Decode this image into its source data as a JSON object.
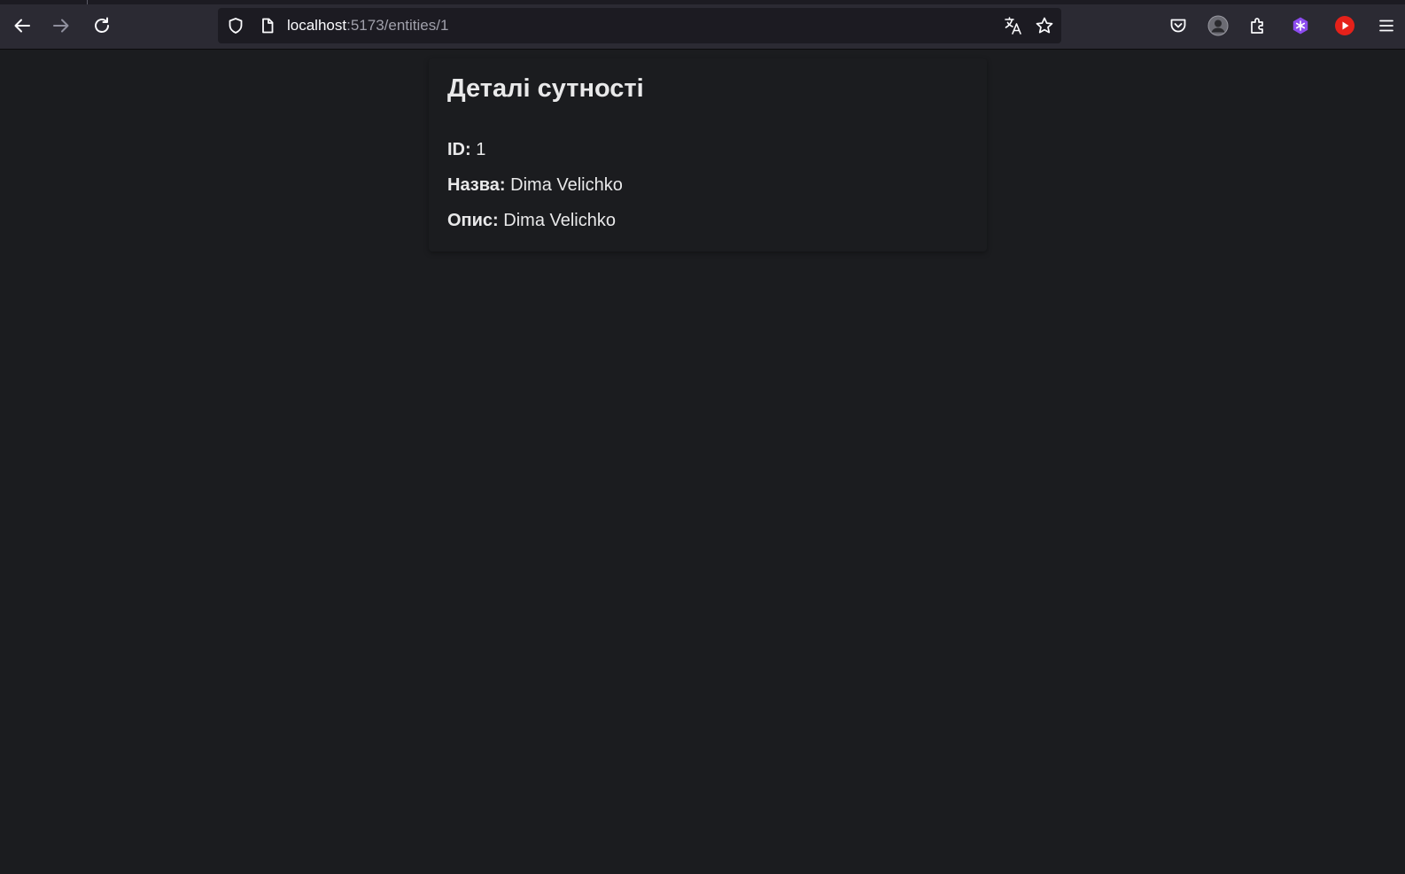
{
  "browser": {
    "url_host": "localhost",
    "url_path": ":5173/entities/1",
    "icons": {
      "back": "arrow-left-icon",
      "forward": "arrow-right-icon",
      "reload": "reload-icon",
      "tracking_protection": "shield-icon",
      "page_info": "page-icon",
      "translate": "translate-icon",
      "bookmark": "star-icon",
      "pocket": "pocket-icon",
      "account": "avatar-icon",
      "extensions": "puzzle-icon",
      "extension_purple": "extension-purple-icon",
      "extension_youtube": "youtube-icon",
      "menu": "hamburger-menu-icon"
    },
    "colors": {
      "toolbar": "#2b2a33",
      "urlbar": "#1c1b22",
      "page_background": "#1b1c1f",
      "text": "#e9e9ea"
    }
  },
  "page": {
    "title": "Деталі сутності",
    "fields": [
      {
        "label": "ID:",
        "value": "1"
      },
      {
        "label": "Назва:",
        "value": "Dima Velichko"
      },
      {
        "label": "Опис:",
        "value": "Dima Velichko"
      }
    ]
  }
}
